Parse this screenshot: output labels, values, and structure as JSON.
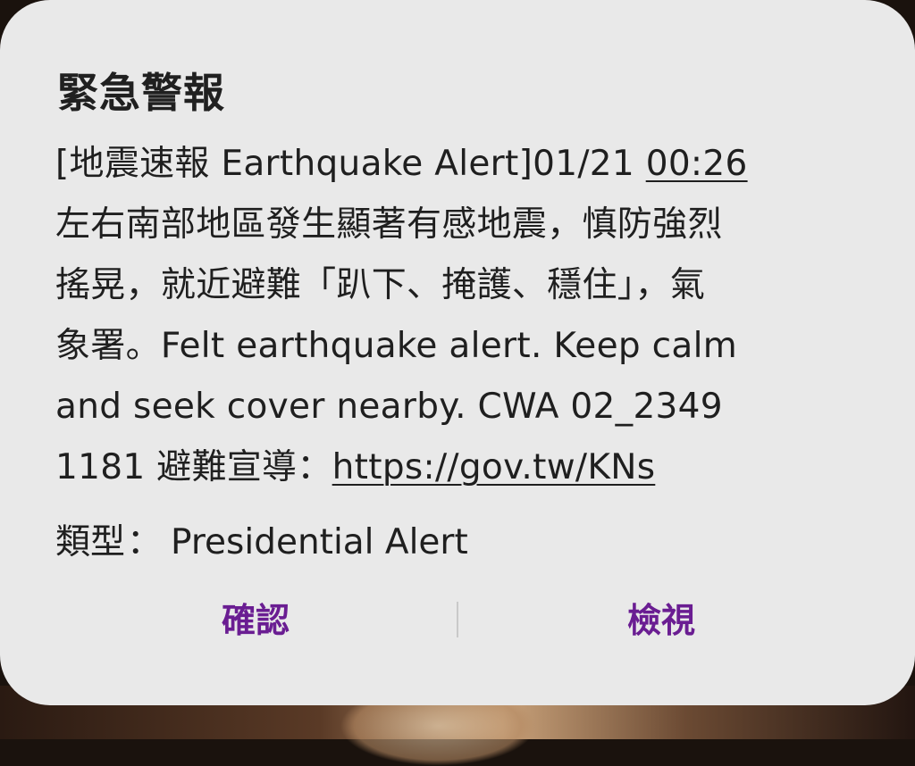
{
  "dialog": {
    "title": "緊急警報",
    "message": {
      "line1_prefix": "[地震速報 Earthquake Alert]01/21 ",
      "line1_time": "00:26",
      "line2": "左右南部地區發生顯著有感地震，慎防強烈",
      "line3": "搖晃，就近避難「趴下、掩護、穩住」，氣",
      "line4": "象署。Felt earthquake alert. Keep calm",
      "line5": "and seek cover nearby. CWA 02_2349",
      "line6_prefix": "1181 避難宣導：",
      "line6_link": "https://gov.tw/KNs"
    },
    "type_label": "類型",
    "type_separator": "：",
    "type_value": "Presidential Alert",
    "buttons": {
      "confirm": "確認",
      "view": "檢視"
    },
    "accent_color": "#6a1d92"
  }
}
